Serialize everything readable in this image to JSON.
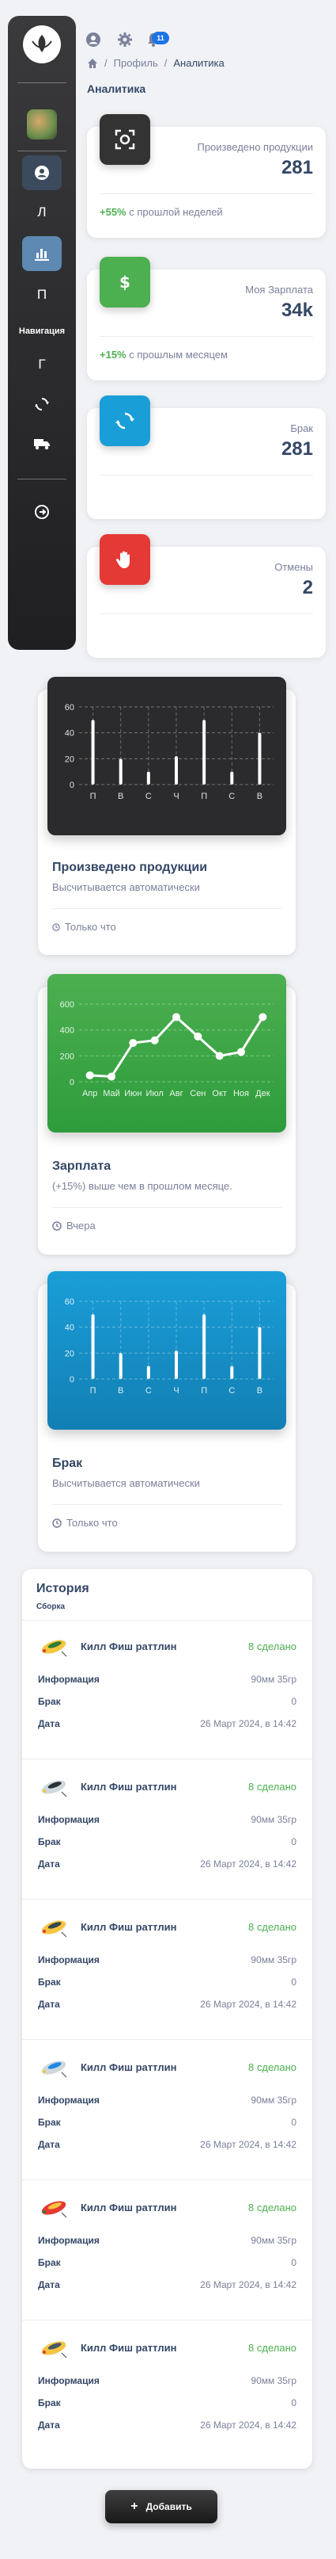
{
  "header": {
    "notification_count": "11",
    "breadcrumb": [
      "Профиль",
      "Аналитика"
    ],
    "page_title": "Аналитика"
  },
  "sidebar": {
    "letters": [
      "Л",
      "П",
      "Г"
    ],
    "heading": "Навигация"
  },
  "stats": [
    {
      "label": "Произведено продукции",
      "value": "281",
      "delta": "+55%",
      "delta_text": " с прошлой неделей",
      "icon": "scan-icon",
      "color": "#333333"
    },
    {
      "label": "Моя Зарплата",
      "value": "34k",
      "delta": "+15%",
      "delta_text": " с прошлым месяцем",
      "icon": "dollar-icon",
      "color": "#4caf50"
    },
    {
      "label": "Брак",
      "value": "281",
      "delta": "",
      "delta_text": "",
      "icon": "refresh-icon",
      "color": "#1a9ed8"
    },
    {
      "label": "Отмены",
      "value": "2",
      "delta": "",
      "delta_text": "",
      "icon": "hand-icon",
      "color": "#e53935"
    }
  ],
  "charts": {
    "production": {
      "title": "Произведено продукции",
      "subtitle": "Высчитывается автоматически",
      "footer": "Только что"
    },
    "salary": {
      "title": "Зарплата",
      "subtitle": "(+15%) выше чем в прошлом месяце.",
      "footer": "Вчера"
    },
    "defects": {
      "title": "Брак",
      "subtitle": "Высчитывается автоматически",
      "footer": "Только что"
    }
  },
  "chart_data": [
    {
      "type": "bar",
      "categories": [
        "П",
        "В",
        "С",
        "Ч",
        "П",
        "С",
        "В"
      ],
      "values": [
        50,
        20,
        10,
        22,
        50,
        10,
        40
      ],
      "yticks": [
        "0",
        "20",
        "40",
        "60"
      ],
      "ylim": [
        0,
        60
      ],
      "background": "#2b2b2d"
    },
    {
      "type": "line",
      "categories": [
        "Апр",
        "Май",
        "Июн",
        "Июл",
        "Авг",
        "Сен",
        "Окт",
        "Ноя",
        "Дек"
      ],
      "values": [
        50,
        40,
        300,
        320,
        500,
        350,
        200,
        230,
        500
      ],
      "yticks": [
        "0",
        "200",
        "400",
        "600"
      ],
      "ylim": [
        0,
        600
      ],
      "background": "#43a047"
    },
    {
      "type": "bar",
      "categories": [
        "П",
        "В",
        "С",
        "Ч",
        "П",
        "С",
        "В"
      ],
      "values": [
        50,
        20,
        10,
        22,
        50,
        10,
        40
      ],
      "yticks": [
        "0",
        "20",
        "40",
        "60"
      ],
      "ylim": [
        0,
        60
      ],
      "background": "#1a9ed8"
    }
  ],
  "history": {
    "title": "История",
    "subtitle": "Сборка",
    "labels": {
      "info": "Информация",
      "defect": "Брак",
      "date": "Дата"
    },
    "items": [
      {
        "name": "Килл Фиш раттлин",
        "status": "8 сделано",
        "info": "90мм 35гр",
        "defect": "0",
        "date": "26 Март 2024, в 14:42"
      },
      {
        "name": "Килл Фиш раттлин",
        "status": "8 сделано",
        "info": "90мм 35гр",
        "defect": "0",
        "date": "26 Март 2024, в 14:42"
      },
      {
        "name": "Килл Фиш раттлин",
        "status": "8 сделано",
        "info": "90мм 35гр",
        "defect": "0",
        "date": "26 Март 2024, в 14:42"
      },
      {
        "name": "Килл Фиш раттлин",
        "status": "8 сделано",
        "info": "90мм 35гр",
        "defect": "0",
        "date": "26 Март 2024, в 14:42"
      },
      {
        "name": "Килл Фиш раттлин",
        "status": "8 сделано",
        "info": "90мм 35гр",
        "defect": "0",
        "date": "26 Март 2024, в 14:42"
      },
      {
        "name": "Килл Фиш раттлин",
        "status": "8 сделано",
        "info": "90мм 35гр",
        "defect": "0",
        "date": "26 Март 2024, в 14:42"
      }
    ]
  },
  "add_button": {
    "label": "Добавить"
  }
}
